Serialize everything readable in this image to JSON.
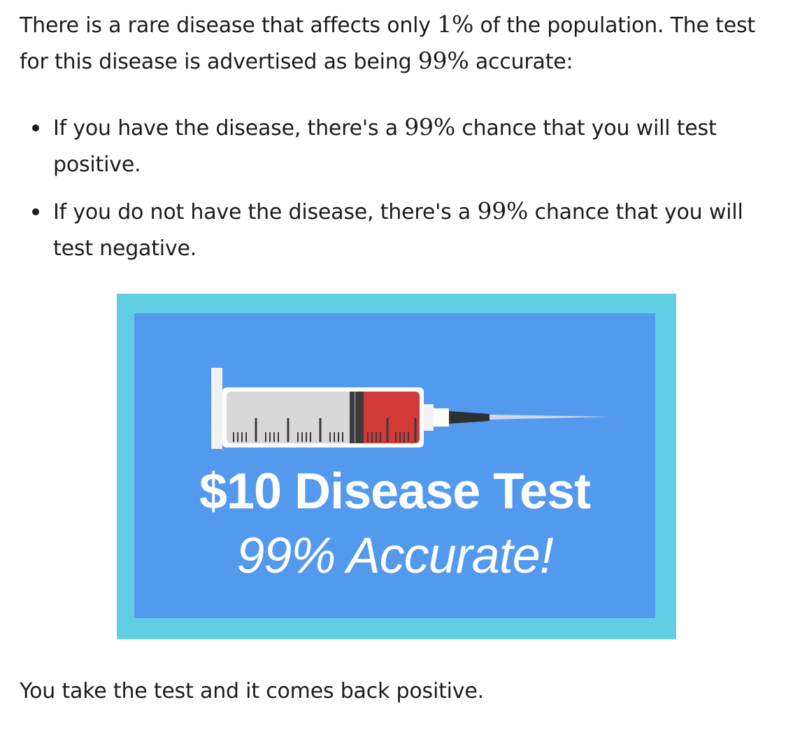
{
  "intro": {
    "part1": "There is a rare disease that affects only ",
    "math1": "1%",
    "part2": " of the population. The test for this disease is advertised as being ",
    "math2": "99%",
    "part3": " accurate:"
  },
  "bullets": [
    {
      "before": "If you have the disease, there's a ",
      "math": "99%",
      "after": " chance that you will test positive."
    },
    {
      "before": "If you do not have the disease, there's a ",
      "math": "99%",
      "after": " chance that you will test negative."
    }
  ],
  "ad": {
    "title": "$10 Disease Test",
    "subtitle": "99% Accurate!",
    "colors": {
      "frame": "#62cee4",
      "background": "#5399ee",
      "blood": "#d23a3a",
      "text": "#ffffff"
    },
    "icon": "syringe-icon"
  },
  "outro": "You take the test and it comes back positive."
}
